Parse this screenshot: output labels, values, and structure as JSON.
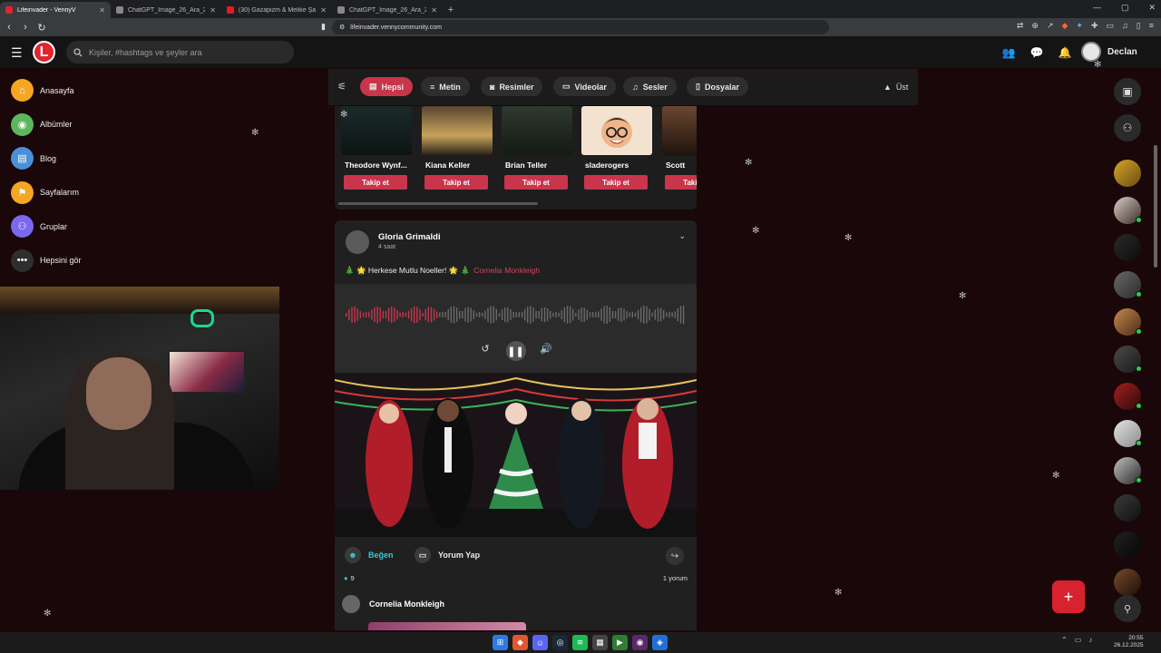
{
  "browser": {
    "tabs": [
      {
        "title": "Lifeinvader - VennyV",
        "active": true
      },
      {
        "title": "ChatGPT_Image_26_Ara_2025_11_0..",
        "active": false
      },
      {
        "title": "(30) Gazapizm & Melike Şahin - Olu..",
        "active": false
      },
      {
        "title": "ChatGPT_Image_26_Ara_2025_11_0..",
        "active": false
      }
    ],
    "url": "lifeinvader.vennycommunity.com"
  },
  "header": {
    "logo": "L",
    "search_placeholder": "Kişiler, #hashtags ve şeyler ara",
    "username": "Declan"
  },
  "sidebar": {
    "items": [
      {
        "label": "Anasayfa",
        "color": "#f5a623",
        "icon": "home-icon"
      },
      {
        "label": "Albümler",
        "color": "#5cb85c",
        "icon": "album-icon"
      },
      {
        "label": "Blog",
        "color": "#4a90d9",
        "icon": "blog-icon"
      },
      {
        "label": "Sayfalarım",
        "color": "#f5a623",
        "icon": "flag-icon"
      },
      {
        "label": "Gruplar",
        "color": "#7b68ee",
        "icon": "group-icon"
      },
      {
        "label": "Hepsini gör",
        "color": "#2e2e2e",
        "icon": "more-icon"
      }
    ]
  },
  "filters": {
    "items": [
      {
        "label": "Hepsi",
        "active": true
      },
      {
        "label": "Metin",
        "active": false
      },
      {
        "label": "Resimler",
        "active": false
      },
      {
        "label": "Videolar",
        "active": false
      },
      {
        "label": "Sesler",
        "active": false
      },
      {
        "label": "Dosyalar",
        "active": false
      }
    ],
    "top_label": "Üst"
  },
  "suggestions": {
    "follow_label": "Takip et",
    "people": [
      {
        "name": "Theodore Wynf..."
      },
      {
        "name": "Kiana Keller"
      },
      {
        "name": "Brian Teller"
      },
      {
        "name": "sladerogers"
      },
      {
        "name": "Scott"
      }
    ]
  },
  "post": {
    "author": "Gloria Grimaldi",
    "time": "4 saat",
    "text": "🎄 🌟 Herkese Mutlu Noeller! 🌟 🎄",
    "mention": "Cornelia Monkleigh",
    "like_label": "Beğen",
    "comment_label": "Yorum Yap",
    "like_count": "9",
    "comment_count": "1 yorum",
    "audio_progress": 0.27
  },
  "comment": {
    "author": "Cornelia Monkleigh"
  },
  "taskbar": {
    "time": "20:55",
    "date": "26.12.2025"
  },
  "colors": {
    "accent": "#c9354b",
    "background": "#1a070a",
    "online": "#2ecc40"
  }
}
